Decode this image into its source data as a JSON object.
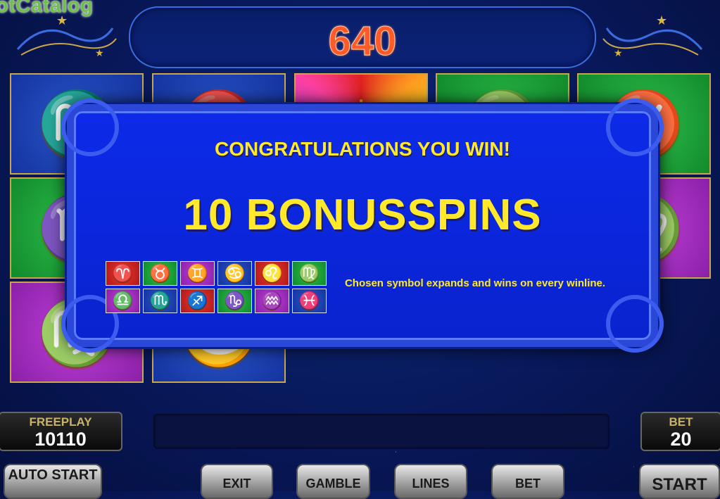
{
  "watermark": "otCatalog",
  "score": "640",
  "popup": {
    "title": "CONGRATULATIONS YOU WIN!",
    "bonus": "10 BONUSSPINS",
    "description": "Chosen symbol expands and wins on every winline."
  },
  "reel_symbols": [
    {
      "name": "scorpio-icon",
      "glyph": "♏",
      "color": "blue"
    },
    {
      "name": "aries-icon",
      "glyph": "♈",
      "color": "blue"
    },
    {
      "name": "sun-icon",
      "glyph": "☀",
      "color": "sun"
    },
    {
      "name": "virgo-icon",
      "glyph": "♍",
      "color": "green"
    },
    {
      "name": "taurus-icon",
      "glyph": "♉",
      "color": "green"
    },
    {
      "name": "capricorn-icon",
      "glyph": "♑",
      "color": "green"
    },
    {
      "name": "gemini-icon",
      "glyph": "♊",
      "color": "purple"
    },
    {
      "name": "sun-icon",
      "glyph": "☀",
      "color": "sun"
    },
    {
      "name": "sagittarius-icon",
      "glyph": "♐",
      "color": "red"
    },
    {
      "name": "virgo-icon",
      "glyph": "♍",
      "color": "purple"
    },
    {
      "name": "virgo-icon",
      "glyph": "♍",
      "color": "purple"
    },
    {
      "name": "cancer-icon",
      "glyph": "♋",
      "color": "blue"
    }
  ],
  "zodiac_symbols": [
    {
      "name": "aries-icon",
      "glyph": "♈",
      "color": "red"
    },
    {
      "name": "taurus-icon",
      "glyph": "♉",
      "color": "green"
    },
    {
      "name": "gemini-icon",
      "glyph": "♊",
      "color": "purple"
    },
    {
      "name": "cancer-icon",
      "glyph": "♋",
      "color": "blue"
    },
    {
      "name": "leo-icon",
      "glyph": "♌",
      "color": "red"
    },
    {
      "name": "virgo-icon",
      "glyph": "♍",
      "color": "green"
    },
    {
      "name": "libra-icon",
      "glyph": "♎",
      "color": "purple"
    },
    {
      "name": "scorpio-icon",
      "glyph": "♏",
      "color": "blue"
    },
    {
      "name": "sagittarius-icon",
      "glyph": "♐",
      "color": "red"
    },
    {
      "name": "capricorn-icon",
      "glyph": "♑",
      "color": "green"
    },
    {
      "name": "aquarius-icon",
      "glyph": "♒",
      "color": "purple"
    },
    {
      "name": "pisces-icon",
      "glyph": "♓",
      "color": "blue"
    }
  ],
  "freeplay": {
    "label": "FREEPLAY",
    "value": "10110"
  },
  "bet_display": {
    "label": "BET",
    "value": "20"
  },
  "buttons": {
    "auto_start": "AUTO START",
    "exit": "EXIT",
    "gamble": "GAMBLE",
    "lines": "LINES",
    "bet": "BET",
    "start": "START"
  },
  "colors": {
    "accent": "#ffe92a",
    "score": "#ff5a2a",
    "popup_bg": "#0c2ae8"
  }
}
